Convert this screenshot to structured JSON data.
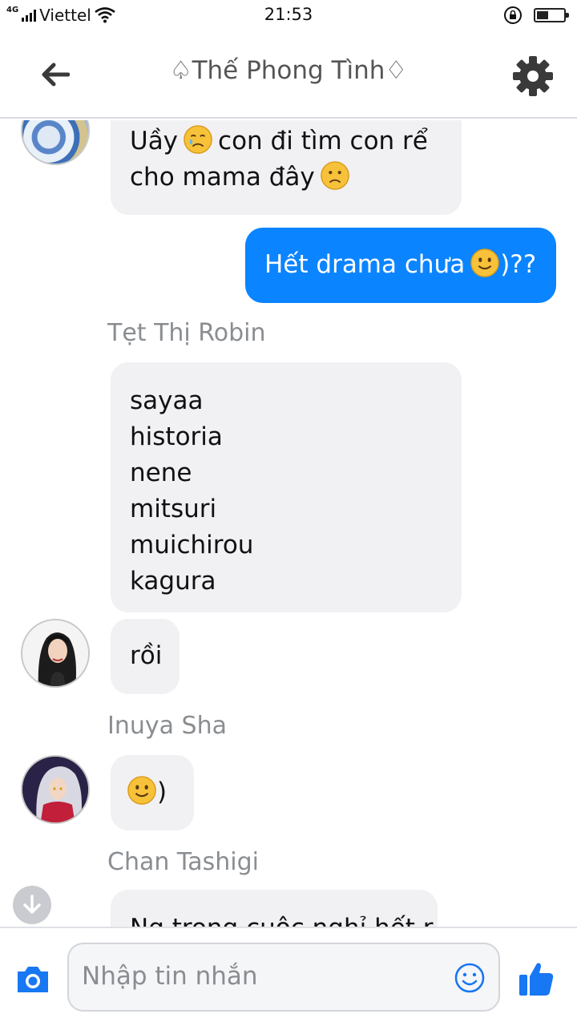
{
  "status_bar": {
    "network_type": "4G",
    "carrier": "Viettel",
    "time": "21:53",
    "battery_level": 0.45,
    "icons": [
      "signal-icon",
      "wifi-icon",
      "rotation-lock-icon",
      "battery-icon"
    ]
  },
  "header": {
    "title": "♤Thế Phong Tình♢",
    "back_icon": "arrow-left-icon",
    "settings_icon": "gear-icon"
  },
  "messages": [
    {
      "type": "incoming",
      "lines": [
        "Uầy",
        "con đi tìm con rể",
        "cho mama đây"
      ],
      "emojis": [
        "crying-face",
        "frowning-face"
      ]
    },
    {
      "type": "outgoing",
      "text_before": "Hết drama chưa",
      "text_after": ")??",
      "emoji": "smiling-face"
    },
    {
      "type": "sender",
      "name": "Tẹt Thị Robin"
    },
    {
      "type": "incoming",
      "lines": [
        "sayaa",
        "historia",
        "nene",
        "mitsuri",
        "muichirou",
        "kagura"
      ]
    },
    {
      "type": "incoming",
      "text": "rồi"
    },
    {
      "type": "sender",
      "name": "Inuya Sha"
    },
    {
      "type": "incoming",
      "text_after": ")",
      "emoji": "smiling-face"
    },
    {
      "type": "sender",
      "name": "Chan Tashigi"
    },
    {
      "type": "incoming",
      "text": "Ng trong cuộc nghỉ hết r"
    }
  ],
  "composer": {
    "placeholder": "Nhập tin nhắn",
    "camera_icon": "camera-icon",
    "emoji_icon": "smile-icon",
    "like_icon": "thumbs-up-icon"
  },
  "colors": {
    "accent": "#0b84ff",
    "incoming_bubble": "#f1f1f4",
    "sender_name": "#8a8d91"
  }
}
